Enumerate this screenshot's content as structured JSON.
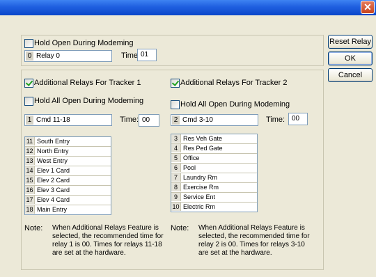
{
  "window": {
    "close_glyph": "✕"
  },
  "top": {
    "hold_open_label": "Hold Open During Modeming",
    "hold_open_checked": false,
    "relay_num": "0",
    "relay_name": "Relay 0",
    "time_label": "Time:",
    "time_value": "01"
  },
  "tracker1": {
    "additional_label": "Additional Relays For Tracker 1",
    "additional_checked": true,
    "hold_all_label": "Hold All Open During Modeming",
    "hold_all_checked": false,
    "relay_num": "1",
    "relay_name": "Cmd 11-18",
    "time_label": "Time:",
    "time_value": "00",
    "relays": [
      {
        "n": "11",
        "name": "South Entry"
      },
      {
        "n": "12",
        "name": "North Entry"
      },
      {
        "n": "13",
        "name": "West Entry"
      },
      {
        "n": "14",
        "name": "Elev 1 Card"
      },
      {
        "n": "15",
        "name": "Elev 2 Card"
      },
      {
        "n": "16",
        "name": "Elev 3 Card"
      },
      {
        "n": "17",
        "name": "Elev 4 Card"
      },
      {
        "n": "18",
        "name": "Main Entry"
      }
    ],
    "note_label": "Note:",
    "note_text": "When Additional Relays Feature is selected, the recommended time for relay 1 is 00. Times for relays 11-18 are set at the hardware."
  },
  "tracker2": {
    "additional_label": "Additional Relays For Tracker 2",
    "additional_checked": true,
    "hold_all_label": "Hold All Open During Modeming",
    "hold_all_checked": false,
    "relay_num": "2",
    "relay_name": "Cmd 3-10",
    "time_label": "Time:",
    "time_value": "00",
    "relays": [
      {
        "n": "3",
        "name": "Res Veh Gate"
      },
      {
        "n": "4",
        "name": "Res Ped Gate"
      },
      {
        "n": "5",
        "name": "Office"
      },
      {
        "n": "6",
        "name": "Pool"
      },
      {
        "n": "7",
        "name": "Laundry Rm"
      },
      {
        "n": "8",
        "name": "Exercise Rm"
      },
      {
        "n": "9",
        "name": "Service Ent"
      },
      {
        "n": "10",
        "name": "Electric Rm"
      }
    ],
    "note_label": "Note:",
    "note_text": "When Additional Relays Feature is selected, the recommended time for relay 2 is 00. Times for relays 3-10 are set at the hardware."
  },
  "buttons": {
    "reset_relay": "Reset Relay",
    "ok": "OK",
    "cancel": "Cancel"
  }
}
